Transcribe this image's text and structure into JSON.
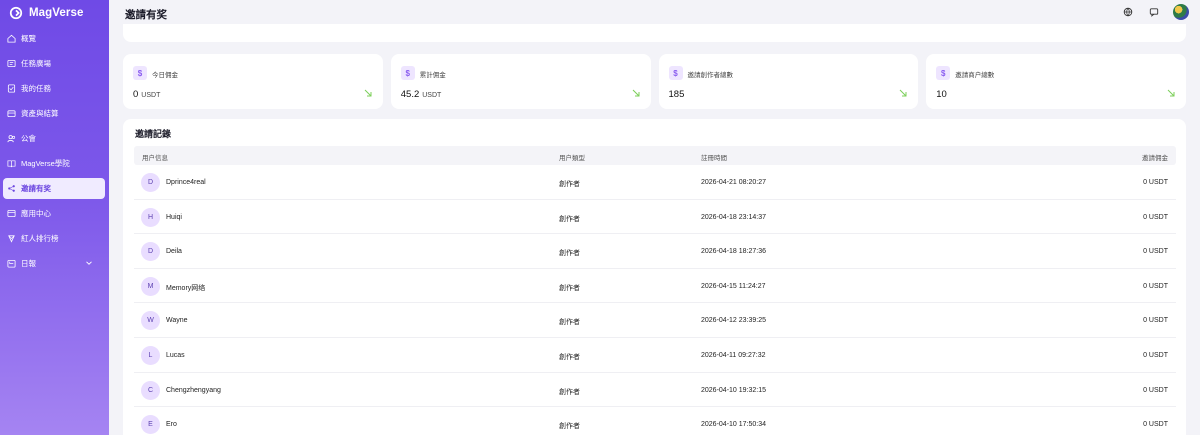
{
  "app": {
    "name": "MagVerse"
  },
  "sidebar": {
    "items": [
      {
        "label": "概覽",
        "icon": "home-icon",
        "active": false
      },
      {
        "label": "任務廣場",
        "icon": "task-square-icon",
        "active": false
      },
      {
        "label": "我的任務",
        "icon": "my-task-icon",
        "active": false
      },
      {
        "label": "資產與結算",
        "icon": "wallet-icon",
        "active": false
      },
      {
        "label": "公會",
        "icon": "users-icon",
        "active": false
      },
      {
        "label": "MagVerse學院",
        "icon": "book-icon",
        "active": false
      },
      {
        "label": "邀請有奖",
        "icon": "share-icon",
        "active": true
      },
      {
        "label": "應用中心",
        "icon": "app-center-icon",
        "active": false
      },
      {
        "label": "紅人排行榜",
        "icon": "trophy-icon",
        "active": false
      },
      {
        "label": "日報",
        "icon": "calendar-icon",
        "active": false,
        "expandable": true
      }
    ]
  },
  "header": {
    "title": "邀請有奖"
  },
  "stats": [
    {
      "label": "今日佣金",
      "value": "0",
      "unit": "USDT"
    },
    {
      "label": "累計佣金",
      "value": "45.2",
      "unit": "USDT"
    },
    {
      "label": "邀請創作者總數",
      "value": "185",
      "unit": ""
    },
    {
      "label": "邀請商户總數",
      "value": "10",
      "unit": ""
    }
  ],
  "records": {
    "title": "邀請記錄",
    "columns": [
      "用户信息",
      "用户類型",
      "註冊時間",
      "邀請佣金"
    ],
    "rows": [
      {
        "initial": "D",
        "name": "Dprince4real",
        "type": "創作者",
        "time": "2026-04-21 08:20:27",
        "commission": "0 USDT"
      },
      {
        "initial": "H",
        "name": "Huiqi",
        "type": "創作者",
        "time": "2026-04-18 23:14:37",
        "commission": "0 USDT"
      },
      {
        "initial": "D",
        "name": "Deila",
        "type": "創作者",
        "time": "2026-04-18 18:27:36",
        "commission": "0 USDT"
      },
      {
        "initial": "M",
        "name": "Memory网络",
        "type": "創作者",
        "time": "2026-04-15 11:24:27",
        "commission": "0 USDT"
      },
      {
        "initial": "W",
        "name": "Wayne",
        "type": "創作者",
        "time": "2026-04-12 23:39:25",
        "commission": "0 USDT"
      },
      {
        "initial": "L",
        "name": "Lucas",
        "type": "創作者",
        "time": "2026-04-11 09:27:32",
        "commission": "0 USDT"
      },
      {
        "initial": "C",
        "name": "Chengzhengyang",
        "type": "創作者",
        "time": "2026-04-10 19:32:15",
        "commission": "0 USDT"
      },
      {
        "initial": "E",
        "name": "Ero",
        "type": "創作者",
        "time": "2026-04-10 17:50:34",
        "commission": "0 USDT"
      }
    ]
  },
  "colors": {
    "accent": "#7b55ea",
    "active_bg": "#f0ebff",
    "trend": "#7ccf5a"
  }
}
